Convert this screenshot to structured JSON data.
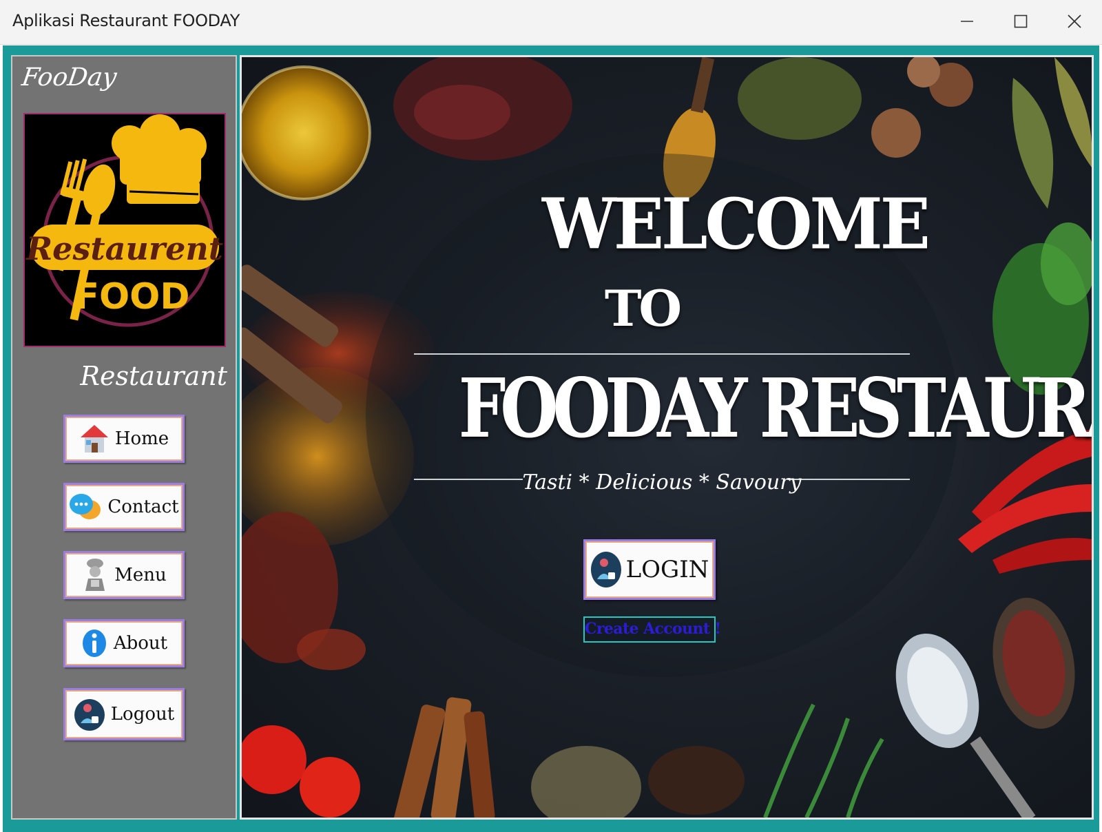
{
  "window": {
    "title": "Aplikasi Restaurant FOODAY",
    "controls": [
      "minimize-icon",
      "maximize-icon",
      "close-icon"
    ]
  },
  "sidebar": {
    "brand": "FooDay",
    "logo": {
      "line1": "Restaurent",
      "line2": "FOOD"
    },
    "section_label": "Restaurant",
    "items": [
      {
        "label": "Home",
        "icon": "house-icon"
      },
      {
        "label": "Contact",
        "icon": "chat-bubbles-icon"
      },
      {
        "label": "Menu",
        "icon": "chef-icon"
      },
      {
        "label": "About",
        "icon": "info-icon"
      },
      {
        "label": "Logout",
        "icon": "user-badge-icon"
      }
    ]
  },
  "main": {
    "welcome": "WELCOME",
    "to": "TO",
    "restaurant_name": "FOODAY RESTAURANT",
    "tagline": "Tasti * Delicious * Savoury",
    "login_label": "LOGIN",
    "create_account_label": "Create Account !"
  },
  "colors": {
    "frame": "#1a9a98",
    "sidebar": "#737373",
    "button_border": "#9b7fe0",
    "create_account_text": "#2b1cd6",
    "create_account_border": "#22c9c4"
  }
}
